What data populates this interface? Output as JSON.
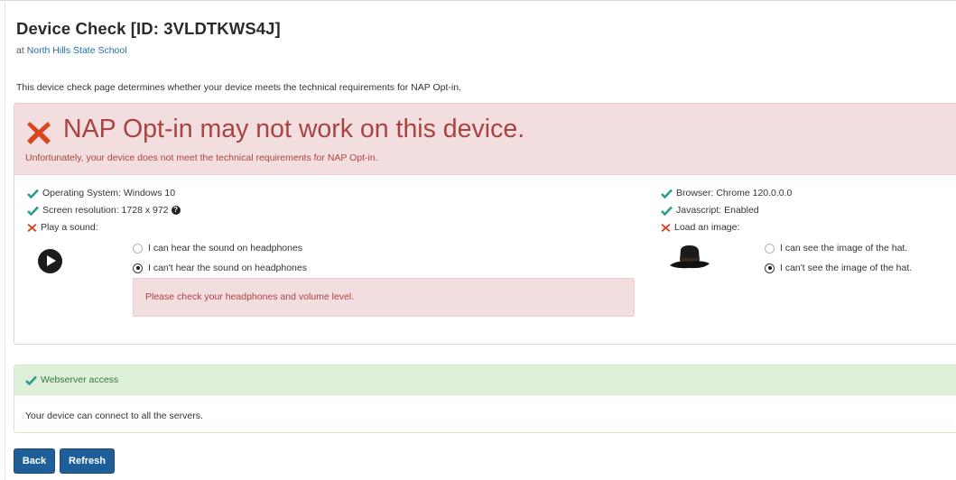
{
  "header": {
    "title": "Device Check [ID: 3VLDTKWS4J]",
    "school_prefix": "at",
    "school_link": "North Hills State School"
  },
  "intro": "This device check page determines whether your device meets the technical requirements for NAP Opt-in.",
  "result": {
    "headline": "NAP Opt-in may not work on this device.",
    "subtext": "Unfortunately, your device does not meet the technical requirements for NAP Opt-in.",
    "status_color": "#a94442"
  },
  "checks": {
    "os": "Operating System: Windows 10",
    "resolution": "Screen resolution: 1728 x 972",
    "sound": "Play a sound:",
    "browser": "Browser: Chrome 120.0.0.0",
    "javascript": "Javascript: Enabled",
    "image": "Load an image:"
  },
  "sound_options": {
    "can_hear": "I can hear the sound on headphones",
    "cant_hear": "I can't hear the sound on headphones",
    "selected": "cant_hear"
  },
  "sound_alert": "Please check your headphones and volume level.",
  "image_options": {
    "can_see": "I can see the image of the hat.",
    "cant_see": "I can't see the image of the hat.",
    "selected": "cant_see"
  },
  "webserver": {
    "heading": "Webserver access",
    "body": "Your device can connect to all the servers."
  },
  "buttons": {
    "back": "Back",
    "refresh": "Refresh"
  },
  "colors": {
    "ok_green": "#2a9d8f",
    "fail_red": "#d9461e",
    "button_blue": "#1f5f99"
  }
}
